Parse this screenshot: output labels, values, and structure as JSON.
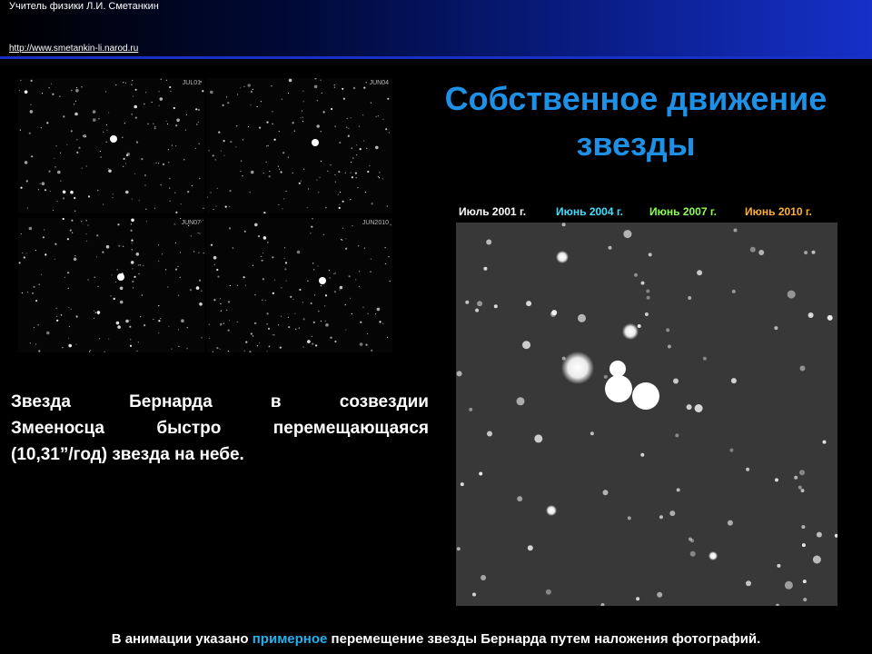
{
  "header": {
    "author": "Учитель физики Л.И. Сметанкин",
    "site": "http://www.smetankin-li.narod.ru"
  },
  "title": {
    "line1": "Собственное движение",
    "line2": "звезды"
  },
  "thumbnails": [
    {
      "code": "JUL01"
    },
    {
      "code": "JUN04"
    },
    {
      "code": "JUN07"
    },
    {
      "code": "JUN2010"
    }
  ],
  "description": {
    "line1": "Звезда Бернарда в созвездии",
    "line2": "Змееносца быстро перемещающаяся",
    "line3": "(10,31”/год) звезда на небе."
  },
  "dates": [
    {
      "label": "Июль 2001 г.",
      "color": "#ffffff"
    },
    {
      "label": "Июнь 2004 г.",
      "color": "#40e0ff"
    },
    {
      "label": "Июнь 2007 г.",
      "color": "#8cff50"
    },
    {
      "label": "Июнь 2010 г.",
      "color": "#ffb030"
    }
  ],
  "footer": {
    "before": "В анимации указано ",
    "highlight": "примерное",
    "after": " перемещение звезды Бернарда путем наложения фотографий."
  },
  "colors": {
    "title": "#1e90e6",
    "header_gradient_end": "#1630c8",
    "highlight": "#20b2f0"
  }
}
